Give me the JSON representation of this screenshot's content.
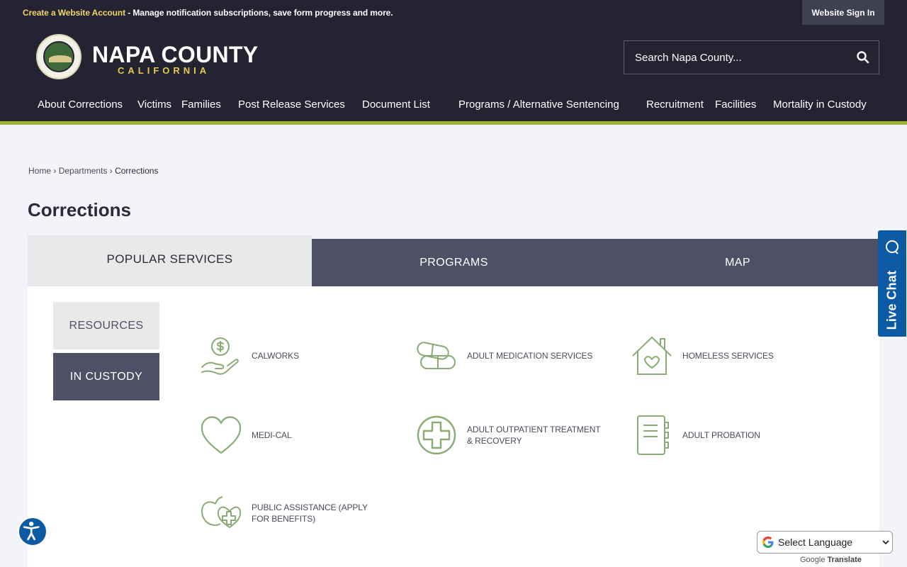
{
  "topbar": {
    "create_account_label": "Create a Website Account",
    "create_account_message": " - Manage notification subscriptions, save form progress and more.",
    "sign_in_label": "Website Sign In"
  },
  "brand": {
    "name": "NAPA COUNTY",
    "subtitle": "CALIFORNIA"
  },
  "search": {
    "placeholder": "Search Napa County..."
  },
  "nav": {
    "items": [
      {
        "label": "About Corrections"
      },
      {
        "label": "Victims"
      },
      {
        "label": "Families"
      },
      {
        "label": "Post Release Services"
      },
      {
        "label": "Document List"
      },
      {
        "label": "Programs / Alternative Sentencing"
      },
      {
        "label": "Recruitment"
      },
      {
        "label": "Facilities"
      },
      {
        "label": "Mortality in Custody"
      }
    ]
  },
  "breadcrumb": {
    "home": "Home",
    "sep": "›",
    "departments": "Departments",
    "current": "Corrections"
  },
  "page": {
    "title": "Corrections"
  },
  "tabs": [
    {
      "label": "POPULAR SERVICES"
    },
    {
      "label": "PROGRAMS"
    },
    {
      "label": "MAP"
    }
  ],
  "subtabs": [
    {
      "label": "RESOURCES"
    },
    {
      "label": "IN CUSTODY"
    }
  ],
  "services": [
    {
      "label": "CALWORKS",
      "icon": "hand-coin-icon"
    },
    {
      "label": "ADULT MEDICATION SERVICES",
      "icon": "pills-icon"
    },
    {
      "label": "HOMELESS SERVICES",
      "icon": "house-heart-icon"
    },
    {
      "label": "MEDI-CAL",
      "icon": "heart-icon"
    },
    {
      "label": "ADULT OUTPATIENT TREATMENT & RECOVERY",
      "icon": "medical-cross-icon"
    },
    {
      "label": "ADULT PROBATION",
      "icon": "notebook-icon"
    },
    {
      "label": "PUBLIC ASSISTANCE (APPLY FOR BENEFITS)",
      "icon": "apple-heart-icon"
    }
  ],
  "widgets": {
    "live_chat_label": "Live Chat",
    "translate_label": "Select Language",
    "powered_by_google": "Google",
    "powered_by_translate": "Translate"
  },
  "colors": {
    "header_bg": "#232331",
    "accent_green": "#9db33a",
    "brand_gold": "#e8c94d",
    "tab_bg": "#4e5065",
    "icon_green": "#8aab76",
    "chat_blue": "#0b5aa3"
  }
}
